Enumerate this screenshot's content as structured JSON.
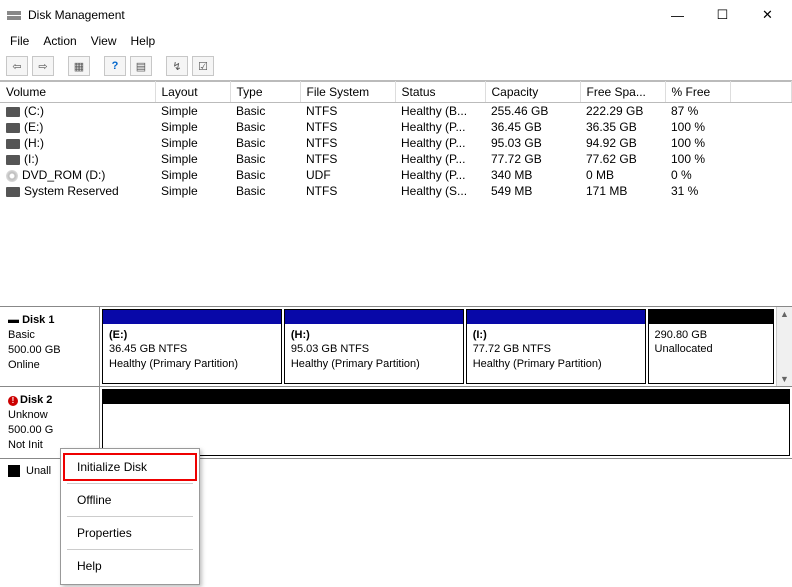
{
  "window": {
    "title": "Disk Management"
  },
  "menubar": [
    "File",
    "Action",
    "View",
    "Help"
  ],
  "columns": [
    "Volume",
    "Layout",
    "Type",
    "File System",
    "Status",
    "Capacity",
    "Free Spa...",
    "% Free"
  ],
  "volumes": [
    {
      "icon": "drive",
      "name": "(C:)",
      "layout": "Simple",
      "vtype": "Basic",
      "fs": "NTFS",
      "status": "Healthy (B...",
      "capacity": "255.46 GB",
      "free": "222.29 GB",
      "pct": "87 %"
    },
    {
      "icon": "drive",
      "name": "(E:)",
      "layout": "Simple",
      "vtype": "Basic",
      "fs": "NTFS",
      "status": "Healthy (P...",
      "capacity": "36.45 GB",
      "free": "36.35 GB",
      "pct": "100 %"
    },
    {
      "icon": "drive",
      "name": "(H:)",
      "layout": "Simple",
      "vtype": "Basic",
      "fs": "NTFS",
      "status": "Healthy (P...",
      "capacity": "95.03 GB",
      "free": "94.92 GB",
      "pct": "100 %"
    },
    {
      "icon": "drive",
      "name": "(I:)",
      "layout": "Simple",
      "vtype": "Basic",
      "fs": "NTFS",
      "status": "Healthy (P...",
      "capacity": "77.72 GB",
      "free": "77.62 GB",
      "pct": "100 %"
    },
    {
      "icon": "cd",
      "name": "DVD_ROM (D:)",
      "layout": "Simple",
      "vtype": "Basic",
      "fs": "UDF",
      "status": "Healthy (P...",
      "capacity": "340 MB",
      "free": "0 MB",
      "pct": "0 %"
    },
    {
      "icon": "drive",
      "name": "System Reserved",
      "layout": "Simple",
      "vtype": "Basic",
      "fs": "NTFS",
      "status": "Healthy (S...",
      "capacity": "549 MB",
      "free": "171 MB",
      "pct": "31 %"
    }
  ],
  "disks": {
    "d1": {
      "name": "Disk 1",
      "type": "Basic",
      "size": "500.00 GB",
      "state": "Online",
      "parts": [
        {
          "label": "(E:)",
          "line2": "36.45 GB NTFS",
          "line3": "Healthy (Primary Partition)",
          "bar": "blue"
        },
        {
          "label": "(H:)",
          "line2": "95.03 GB NTFS",
          "line3": "Healthy (Primary Partition)",
          "bar": "blue"
        },
        {
          "label": "(I:)",
          "line2": "77.72 GB NTFS",
          "line3": "Healthy (Primary Partition)",
          "bar": "blue"
        },
        {
          "label": "",
          "line2": "290.80 GB",
          "line3": "Unallocated",
          "bar": "black"
        }
      ]
    },
    "d2": {
      "name": "Disk 2",
      "type": "Unknow",
      "size": "500.00 G",
      "state": "Not Init"
    }
  },
  "legend": {
    "unallocated": "Unall"
  },
  "context": {
    "initialize": "Initialize Disk",
    "offline": "Offline",
    "properties": "Properties",
    "help": "Help"
  }
}
